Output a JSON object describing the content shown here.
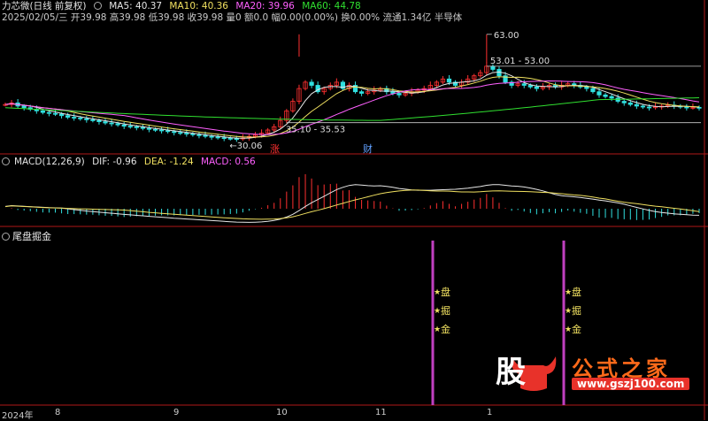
{
  "header": {
    "title": "力芯微(日线 前复权)",
    "ma": [
      {
        "label": "MA5: 40.37",
        "color": "#e6e6e6"
      },
      {
        "label": "MA10: 40.36",
        "color": "#f0e060"
      },
      {
        "label": "MA20: 39.96",
        "color": "#ff60ff"
      },
      {
        "label": "MA60: 44.78",
        "color": "#30e030"
      }
    ],
    "quote": "2025/02/05/三 开39.98 高39.98 低39.98 收39.98 量0 额0.0 幅0.00(0.00%) 换0.00% 流通1.34亿 半导体"
  },
  "macd_panel": {
    "title": "MACD(12,26,9)",
    "dif": "DIF: -0.96",
    "dea": "DEA: -1.24",
    "macd": "MACD: 0.56"
  },
  "indicator_panel": {
    "title": "尾盘掘金",
    "signal_chars": [
      "盘",
      "掘",
      "金"
    ]
  },
  "timeline": {
    "labels": [
      "2024年",
      "8",
      "9",
      "10",
      "11",
      "1"
    ]
  },
  "logo": {
    "mark": "股",
    "text": "公式之家",
    "url": "www.gszj100.com"
  },
  "colors": {
    "up": "#ff3030",
    "down": "#30e0e0",
    "ma5": "#e6e6e6",
    "ma10": "#f0e060",
    "ma20": "#ff60ff",
    "ma60": "#30e030",
    "signal": "#c040c0",
    "panel_border": "#b01818"
  },
  "chart_data": [
    {
      "type": "candlestick",
      "title": "力芯微(日线 前复权)",
      "annotations": [
        "63.00",
        "53.01 - 53.00",
        "35.10 - 35.53",
        "30.06",
        "涨",
        "财"
      ],
      "ylim": [
        28,
        66
      ],
      "closes": [
        41,
        41.5,
        40.5,
        40,
        39.5,
        39,
        38.5,
        38.2,
        38,
        37.5,
        37,
        36.8,
        36.5,
        36.2,
        36,
        35.6,
        35.2,
        35,
        34.6,
        34.2,
        34,
        33.8,
        33.5,
        33.2,
        33,
        32.8,
        32.5,
        32.2,
        32,
        31.8,
        31.5,
        31.3,
        31,
        30.8,
        30.6,
        30.4,
        30.3,
        30.2,
        30.5,
        31,
        31.5,
        32,
        33,
        34,
        36,
        39,
        42,
        46,
        48,
        47,
        45,
        46,
        47,
        48,
        46,
        47,
        45,
        44.5,
        45,
        45.5,
        46,
        45,
        44.5,
        44,
        44.5,
        45,
        45.5,
        46,
        47,
        48,
        49,
        48,
        47,
        48,
        49,
        50,
        51,
        53,
        52,
        50,
        48,
        47,
        47.5,
        47,
        46.5,
        46,
        46.5,
        47,
        46.5,
        47,
        47.5,
        47,
        46.5,
        46,
        45,
        44,
        43.5,
        43,
        42,
        41.5,
        41,
        40.5,
        40.2,
        40,
        40.3,
        40.5,
        40.8,
        40.5,
        40.2,
        40,
        40.1,
        39.98
      ],
      "ma_series": [
        "MA5",
        "MA10",
        "MA20",
        "MA60"
      ]
    },
    {
      "type": "bar",
      "title": "MACD(12,26,9)",
      "series": [
        {
          "name": "DIF",
          "values": [
            -0.96
          ]
        },
        {
          "name": "DEA",
          "values": [
            -1.24
          ]
        },
        {
          "name": "MACD",
          "values": [
            0.56
          ]
        }
      ]
    }
  ]
}
